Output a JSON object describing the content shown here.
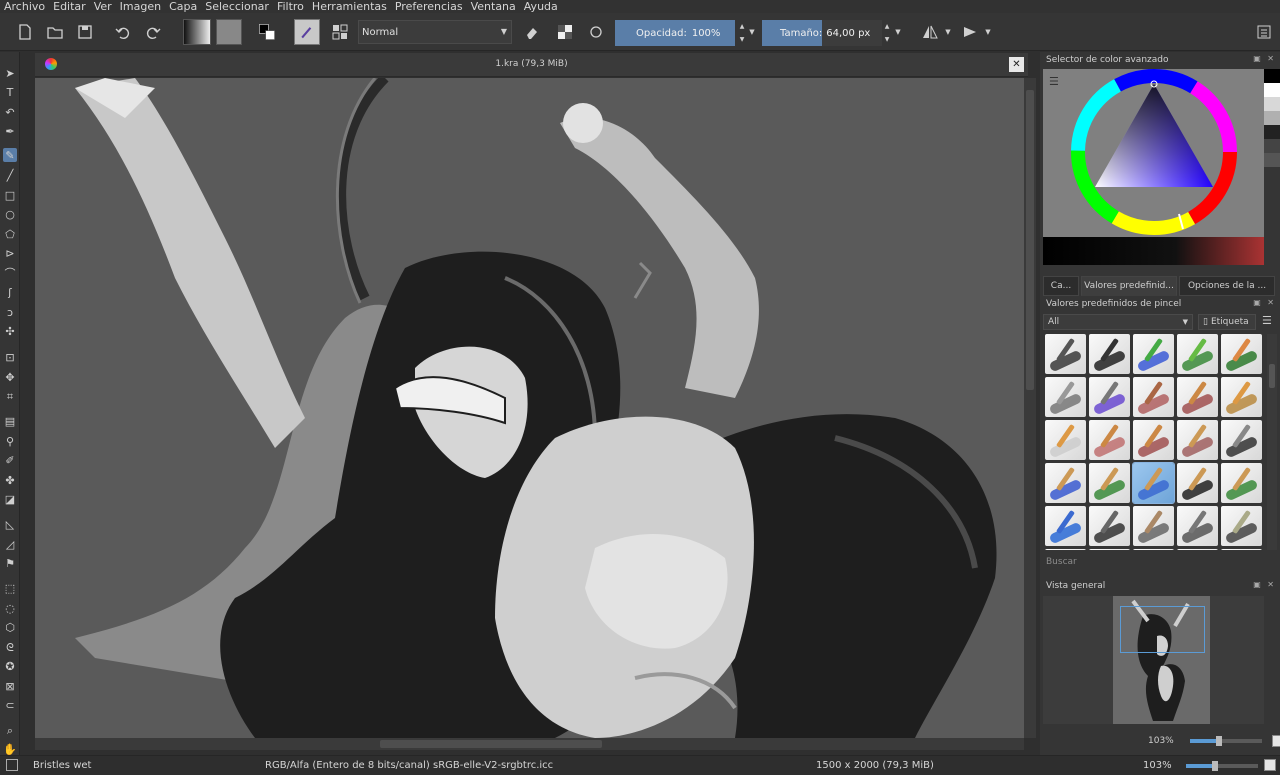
{
  "menu": [
    "Archivo",
    "Editar",
    "Ver",
    "Imagen",
    "Capa",
    "Seleccionar",
    "Filtro",
    "Herramientas",
    "Preferencias",
    "Ventana",
    "Ayuda"
  ],
  "toolbar": {
    "blend_mode": "Normal",
    "opacity_label": "Opacidad:",
    "opacity_value": "100%",
    "opacity_fraction": 1.0,
    "size_label": "Tamaño:",
    "size_value": "64,00 px",
    "size_fraction": 0.5
  },
  "document": {
    "title": "1.kra (79,3 MiB)"
  },
  "docker": {
    "color_selector_title": "Selector de color avanzado",
    "tabs": [
      "Ca...",
      "Valores predefinid...",
      "Opciones de la ..."
    ],
    "presets_title": "Valores predefinidos de pincel",
    "filter_value": "All",
    "tag_label": "Etiqueta",
    "search_placeholder": "Buscar",
    "overview_title": "Vista general",
    "zoom_1": "103%",
    "zoom_2": "103%"
  },
  "colors": {
    "accent": "#5a7ea8",
    "selection": "#5b9bd5",
    "canvas_bg": "#5a5a5a",
    "panel_bg": "#353535"
  },
  "presets": [
    {
      "stroke": "#3a3a3a",
      "brush": "#555"
    },
    {
      "stroke": "#222222",
      "brush": "#333"
    },
    {
      "stroke": "#3b5bd6",
      "brush": "#4a4"
    },
    {
      "stroke": "#3a8a3a",
      "brush": "#6b4"
    },
    {
      "stroke": "#2e7a2e",
      "brush": "#d84"
    },
    {
      "stroke": "#777777",
      "brush": "#999"
    },
    {
      "stroke": "#6a4ad0",
      "brush": "#777"
    },
    {
      "stroke": "#b06060",
      "brush": "#a64"
    },
    {
      "stroke": "#a05050",
      "brush": "#c84"
    },
    {
      "stroke": "#b88a40",
      "brush": "#d94"
    },
    {
      "stroke": "#cccccc",
      "brush": "#d94"
    },
    {
      "stroke": "#c07070",
      "brush": "#c84"
    },
    {
      "stroke": "#a05050",
      "brush": "#c84"
    },
    {
      "stroke": "#a06060",
      "brush": "#c95"
    },
    {
      "stroke": "#333333",
      "brush": "#888"
    },
    {
      "stroke": "#3a5ad0",
      "brush": "#c95"
    },
    {
      "stroke": "#3a8a3a",
      "brush": "#c95"
    },
    {
      "stroke": "#3b6ad0",
      "brush": "#c95"
    },
    {
      "stroke": "#222222",
      "brush": "#c95"
    },
    {
      "stroke": "#3a8a3a",
      "brush": "#c95"
    },
    {
      "stroke": "#2a6ad6",
      "brush": "#3b6ad0"
    },
    {
      "stroke": "#333333",
      "brush": "#666"
    },
    {
      "stroke": "#666666",
      "brush": "#a86"
    },
    {
      "stroke": "#555555",
      "brush": "#777"
    },
    {
      "stroke": "#444444",
      "brush": "#aa8"
    },
    {
      "stroke": "#3a7a3a",
      "brush": "#3a6a3a"
    },
    {
      "stroke": "#a57a30",
      "brush": "#a57a30"
    },
    {
      "stroke": "#333333",
      "brush": "#888"
    },
    {
      "stroke": "#333333",
      "brush": "#888"
    },
    {
      "stroke": "#333333",
      "brush": "#888"
    }
  ],
  "status": {
    "brush_name": "Bristles wet",
    "color_space": "RGB/Alfa (Entero de 8 bits/canal)  sRGB-elle-V2-srgbtrc.icc",
    "dimensions": "1500 x 2000 (79,3 MiB)",
    "zoom": "103%"
  }
}
